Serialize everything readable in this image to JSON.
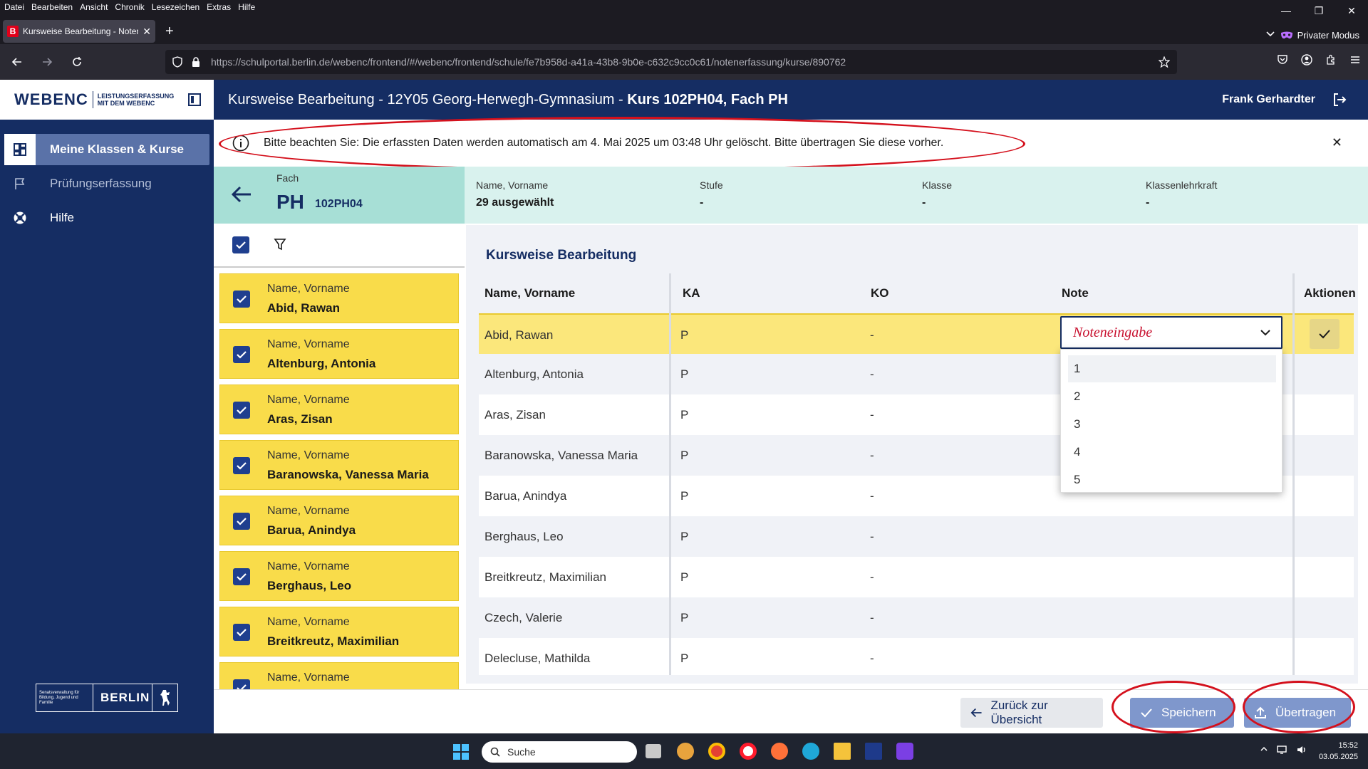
{
  "browser": {
    "menu": [
      "Datei",
      "Bearbeiten",
      "Ansicht",
      "Chronik",
      "Lesezeichen",
      "Extras",
      "Hilfe"
    ],
    "tab_title": "Kursweise Bearbeitung - Notene",
    "private_label": "Privater Modus",
    "url": "https://schulportal.berlin.de/webenc/frontend/#/webenc/frontend/schule/fe7b958d-a41a-43b8-9b0e-c632c9cc0c61/notenerfassung/kurse/890762"
  },
  "app": {
    "logo_word": "WEBENC",
    "logo_sub1": "LEISTUNGSERFASSUNG",
    "logo_sub2": "MIT DEM WEBENC",
    "title_prefix": "Kursweise Bearbeitung - 12Y05 Georg-Herwegh-Gymnasium - ",
    "title_bold": "Kurs 102PH04, Fach PH",
    "user": "Frank Gerhardter"
  },
  "sidebar": {
    "items": [
      {
        "label": "Meine Klassen & Kurse",
        "icon": "dashboard-icon"
      },
      {
        "label": "Prüfungserfassung",
        "icon": "flag-icon"
      },
      {
        "label": "Hilfe",
        "icon": "lifebuoy-icon"
      }
    ],
    "berlin_sender": "Senatsverwaltung für Bildung, Jugend und Familie",
    "berlin_text": "BERLIN"
  },
  "notice": "Bitte beachten Sie: Die erfassten Daten werden automatisch am 4. Mai 2025 um 03:48 Uhr gelöscht. Bitte übertragen Sie diese vorher.",
  "fach": {
    "label": "Fach",
    "code": "PH",
    "kurs": "102PH04"
  },
  "info": [
    {
      "label": "Name, Vorname",
      "value": "29 ausgewählt"
    },
    {
      "label": "Stufe",
      "value": "-"
    },
    {
      "label": "Klasse",
      "value": "-"
    },
    {
      "label": "Klassenlehrkraft",
      "value": "-"
    }
  ],
  "card_label": "Name, Vorname",
  "students_list": [
    "Abid, Rawan",
    "Altenburg, Antonia",
    "Aras, Zisan",
    "Baranowska, Vanessa Maria",
    "Barua, Anindya",
    "Berghaus, Leo",
    "Breitkreutz, Maximilian"
  ],
  "panel_title": "Kursweise Bearbeitung",
  "table": {
    "headers": [
      "Name, Vorname",
      "KA",
      "KO",
      "Note",
      "Aktionen"
    ],
    "rows": [
      {
        "name": "Abid, Rawan",
        "ka": "P",
        "ko": "-"
      },
      {
        "name": "Altenburg, Antonia",
        "ka": "P",
        "ko": "-"
      },
      {
        "name": "Aras, Zisan",
        "ka": "P",
        "ko": "-"
      },
      {
        "name": "Baranowska, Vanessa Maria",
        "ka": "P",
        "ko": "-"
      },
      {
        "name": "Barua, Anindya",
        "ka": "P",
        "ko": "-"
      },
      {
        "name": "Berghaus, Leo",
        "ka": "P",
        "ko": "-"
      },
      {
        "name": "Breitkreutz, Maximilian",
        "ka": "P",
        "ko": "-"
      },
      {
        "name": "Czech, Valerie",
        "ka": "P",
        "ko": "-"
      },
      {
        "name": "Delecluse, Mathilda",
        "ka": "P",
        "ko": "-"
      }
    ]
  },
  "grade_dropdown": {
    "placeholder": "Noteneingabe",
    "options": [
      "1",
      "2",
      "3",
      "4",
      "5"
    ]
  },
  "buttons": {
    "back": "Zurück zur Übersicht",
    "save": "Speichern",
    "upload": "Übertragen"
  },
  "taskbar": {
    "search": "Suche",
    "time": "15:52",
    "date": "03.05.2025"
  }
}
